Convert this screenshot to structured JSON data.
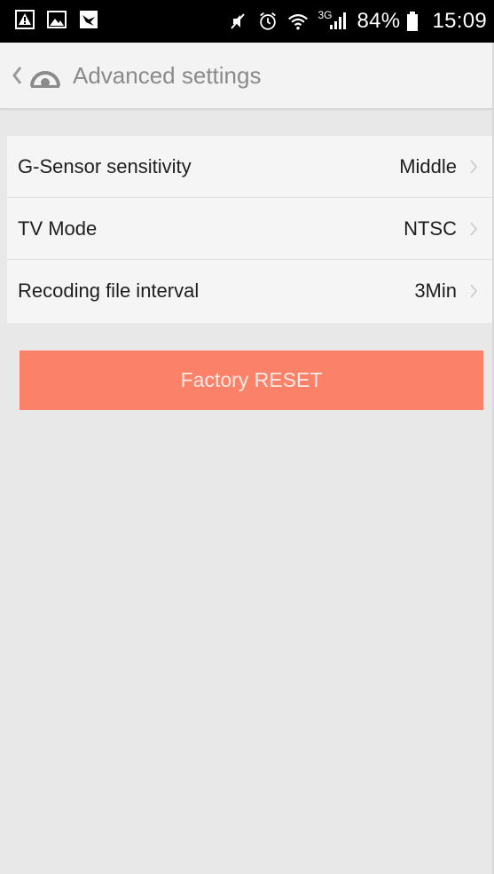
{
  "status_bar": {
    "icons_left": [
      "alert-image-icon",
      "image-icon",
      "app-notification-icon"
    ],
    "icons_right": [
      "mute-icon",
      "alarm-icon",
      "wifi-icon",
      "signal-icon",
      "battery-icon"
    ],
    "network": "3G",
    "battery": "84%",
    "time": "15:09"
  },
  "header": {
    "title": "Advanced settings"
  },
  "settings": [
    {
      "label": "G-Sensor sensitivity",
      "value": "Middle"
    },
    {
      "label": "TV Mode",
      "value": "NTSC"
    },
    {
      "label": "Recoding file interval",
      "value": "3Min"
    }
  ],
  "reset": {
    "label": "Factory RESET"
  },
  "colors": {
    "accent": "#fb8169",
    "background": "#e8e8e8",
    "header": "#f3f3f3",
    "list": "#f5f5f5"
  }
}
